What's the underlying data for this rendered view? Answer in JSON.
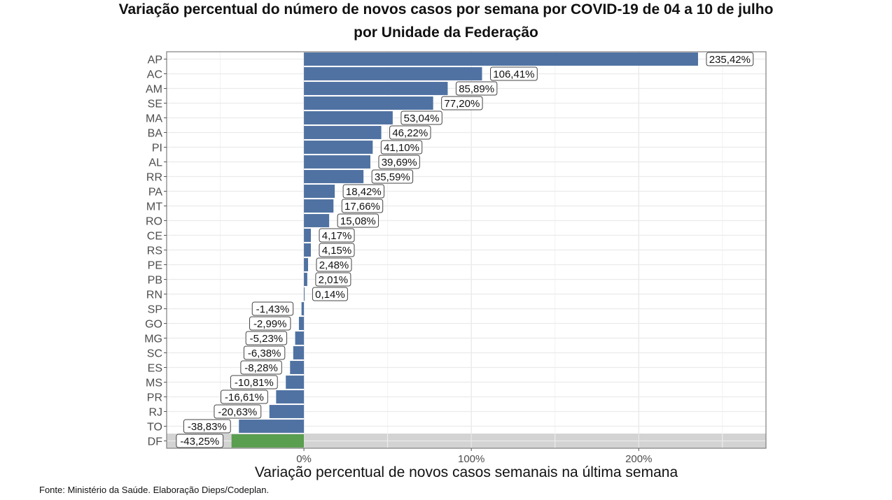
{
  "chart_data": {
    "type": "bar",
    "orientation": "horizontal",
    "title": "Variação percentual do número de novos casos por semana por COVID-19 de 04 a 10 de julho",
    "subtitle": "por Unidade da Federação",
    "xlabel": "Variação percentual de novos casos semanais na última semana",
    "ylabel": "",
    "xlim": [
      -82,
      276
    ],
    "x_ticks": [
      0,
      100,
      200
    ],
    "x_tick_labels": [
      "0%",
      "100%",
      "200%"
    ],
    "grid": true,
    "highlight_category": "DF",
    "colors": {
      "default": "#4f72a2",
      "highlight": "#5a9e4f",
      "highlight_band": "#d3d3d3"
    },
    "categories": [
      "AP",
      "AC",
      "AM",
      "SE",
      "MA",
      "BA",
      "PI",
      "AL",
      "RR",
      "PA",
      "MT",
      "RO",
      "CE",
      "RS",
      "PE",
      "PB",
      "RN",
      "SP",
      "GO",
      "MG",
      "SC",
      "ES",
      "MS",
      "PR",
      "RJ",
      "TO",
      "DF"
    ],
    "values": [
      235.42,
      106.41,
      85.89,
      77.2,
      53.04,
      46.22,
      41.1,
      39.69,
      35.59,
      18.42,
      17.66,
      15.08,
      4.17,
      4.15,
      2.48,
      2.01,
      0.14,
      -1.43,
      -2.99,
      -5.23,
      -6.38,
      -8.28,
      -10.81,
      -16.61,
      -20.63,
      -38.83,
      -43.25
    ],
    "data_labels": [
      "235,42%",
      "106,41%",
      "85,89%",
      "77,20%",
      "53,04%",
      "46,22%",
      "41,10%",
      "39,69%",
      "35,59%",
      "18,42%",
      "17,66%",
      "15,08%",
      "4,17%",
      "4,15%",
      "2,48%",
      "2,01%",
      "0,14%",
      "-1,43%",
      "-2,99%",
      "-5,23%",
      "-6,38%",
      "-8,28%",
      "-10,81%",
      "-16,61%",
      "-20,63%",
      "-38,83%",
      "-43,25%"
    ]
  },
  "source": "Fonte:  Ministério da Saúde. Elaboração Dieps/Codeplan."
}
